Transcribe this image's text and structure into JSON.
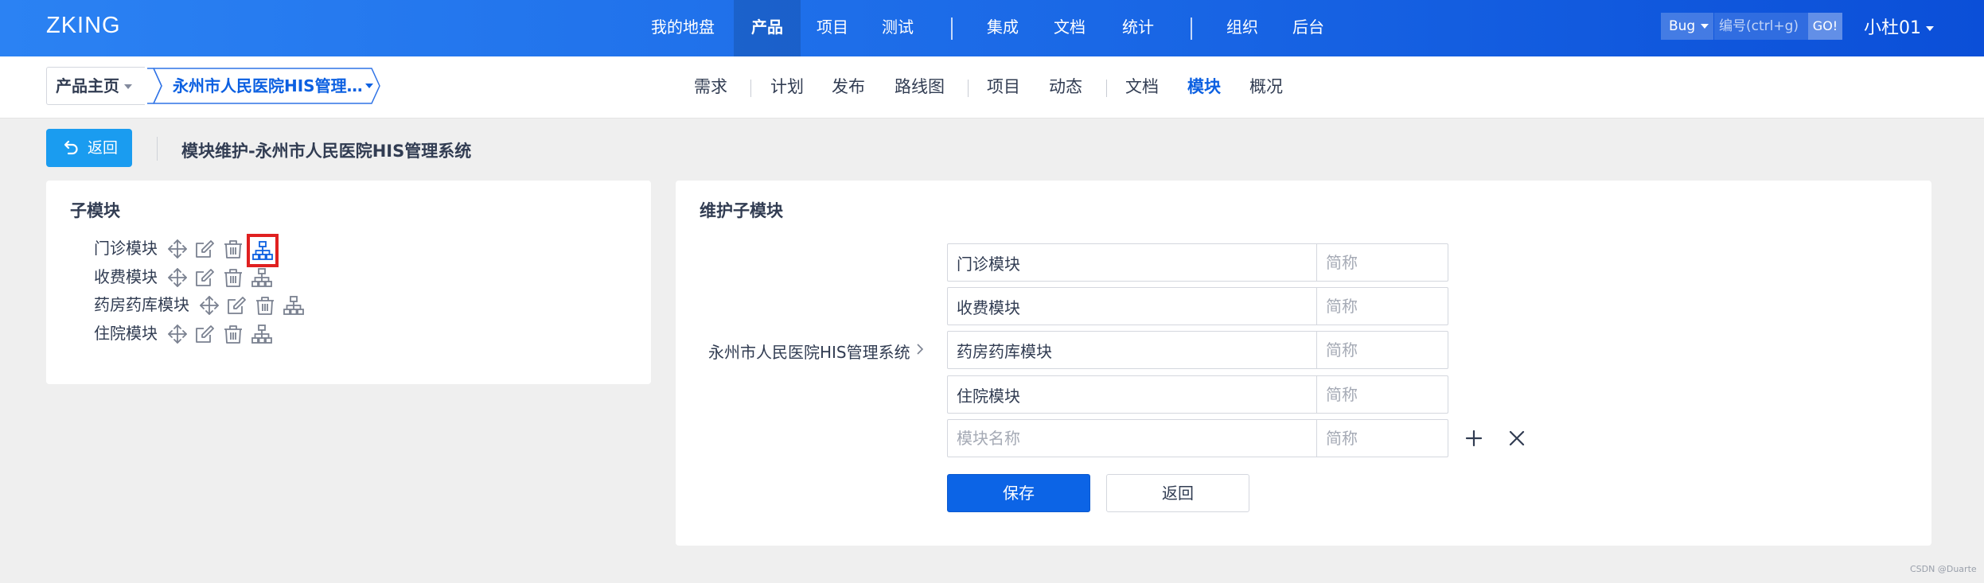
{
  "brand": "ZKING",
  "main_nav": {
    "items": [
      {
        "label": "我的地盘",
        "active": false
      },
      {
        "label": "产品",
        "active": true
      },
      {
        "label": "项目",
        "active": false
      },
      {
        "label": "测试",
        "active": false
      },
      {
        "label": "集成",
        "active": false
      },
      {
        "label": "文档",
        "active": false
      },
      {
        "label": "统计",
        "active": false
      },
      {
        "label": "组织",
        "active": false
      },
      {
        "label": "后台",
        "active": false
      }
    ]
  },
  "search": {
    "type_label": "Bug",
    "placeholder": "编号(ctrl+g)",
    "go_label": "GO!"
  },
  "user": {
    "name": "小杜01"
  },
  "breadcrumb": {
    "home_label": "产品主页",
    "product_label": "永州市人民医院HIS管理…"
  },
  "sub_nav": {
    "items": [
      {
        "label": "需求",
        "active": false
      },
      {
        "label": "计划",
        "active": false
      },
      {
        "label": "发布",
        "active": false
      },
      {
        "label": "路线图",
        "active": false
      },
      {
        "label": "项目",
        "active": false
      },
      {
        "label": "动态",
        "active": false
      },
      {
        "label": "文档",
        "active": false
      },
      {
        "label": "模块",
        "active": true
      },
      {
        "label": "概况",
        "active": false
      }
    ]
  },
  "toolbar": {
    "back_label": "返回",
    "page_title": "模块维护-永州市人民医院HIS管理系统"
  },
  "left_panel": {
    "title": "子模块",
    "modules": [
      {
        "name": "门诊模块",
        "highlighted_action": "child"
      },
      {
        "name": "收费模块",
        "highlighted_action": ""
      },
      {
        "name": "药房药库模块",
        "highlighted_action": ""
      },
      {
        "name": "住院模块",
        "highlighted_action": ""
      }
    ],
    "icons": [
      "move-icon",
      "edit-icon",
      "delete-icon",
      "child-module-icon"
    ]
  },
  "right_panel": {
    "title": "维护子模块",
    "parent_label": "永州市人民医院HIS管理系统",
    "rows": [
      {
        "name": "门诊模块",
        "short_placeholder": "简称"
      },
      {
        "name": "收费模块",
        "short_placeholder": "简称"
      },
      {
        "name": "药房药库模块",
        "short_placeholder": "简称"
      },
      {
        "name": "住院模块",
        "short_placeholder": "简称"
      }
    ],
    "new_row": {
      "name_placeholder": "模块名称",
      "short_placeholder": "简称"
    },
    "save_label": "保存",
    "return_label": "返回"
  },
  "colors": {
    "primary": "#0c64e6",
    "nav_gradient_start": "#2b82f3",
    "nav_gradient_end": "#0b4fd8",
    "back_button": "#1a9cf0",
    "highlight_frame": "#e02020"
  },
  "watermark": "CSDN @Duarte"
}
